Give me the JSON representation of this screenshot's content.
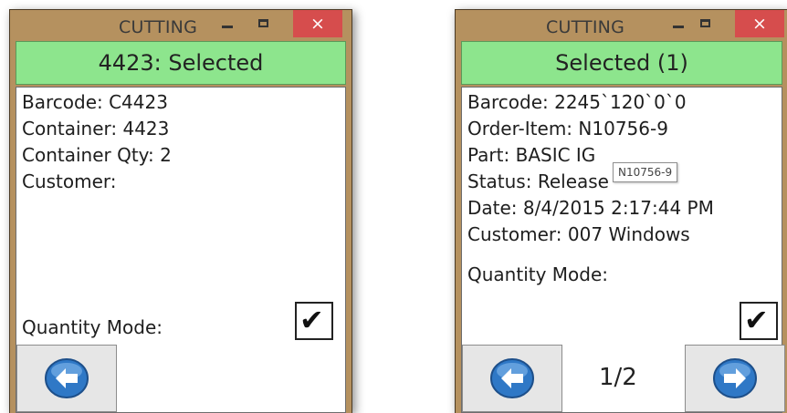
{
  "window_left": {
    "title": "CUTTING",
    "close_glyph": "×",
    "banner": "4423: Selected",
    "fields": [
      {
        "label": "Barcode:",
        "value": "C4423"
      },
      {
        "label": "Container:",
        "value": "4423"
      },
      {
        "label": "Container Qty:",
        "value": "2"
      },
      {
        "label": "Customer:",
        "value": ""
      }
    ],
    "quantity_mode_label": "Quantity Mode:",
    "quantity_mode_checked": "✔"
  },
  "window_right": {
    "title": "CUTTING",
    "close_glyph": "×",
    "banner": "Selected (1)",
    "fields": [
      {
        "label": "Barcode:",
        "value": "2245`120`0`0"
      },
      {
        "label": "Order-Item:",
        "value": "N10756-9"
      },
      {
        "label": "Part:",
        "value": "BASIC IG"
      },
      {
        "label": "Status:",
        "value": "Release"
      },
      {
        "label": "Date:",
        "value": "8/4/2015 2:17:44 PM"
      },
      {
        "label": "Customer:",
        "value": "007 Windows"
      }
    ],
    "tooltip": "N10756-9",
    "quantity_mode_label": "Quantity Mode:",
    "quantity_mode_checked": "✔",
    "pager": "1/2"
  },
  "icons": {
    "back": "back-arrow-icon",
    "forward": "forward-arrow-icon",
    "check": "checkmark-icon"
  },
  "colors": {
    "window_frame": "#b5915f",
    "banner_green": "#8de58d",
    "close_red": "#d64d4d",
    "nav_blue": "#2f78c6"
  }
}
